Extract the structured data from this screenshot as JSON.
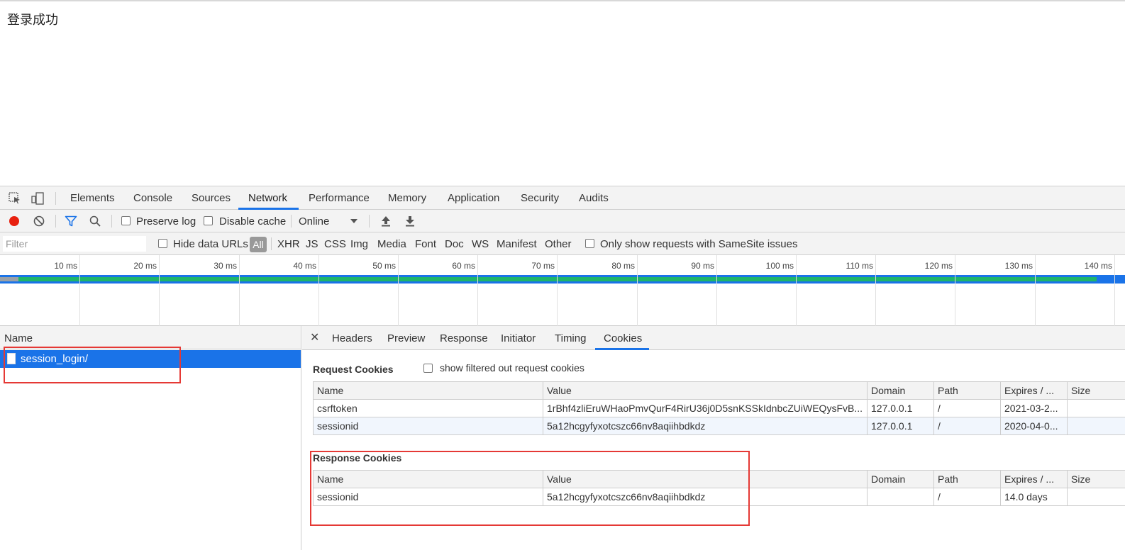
{
  "page": {
    "message": "登录成功"
  },
  "devtools": {
    "tabs": [
      "Elements",
      "Console",
      "Sources",
      "Network",
      "Performance",
      "Memory",
      "Application",
      "Security",
      "Audits"
    ],
    "active_tab": "Network",
    "toolbar": {
      "preserve_log": "Preserve log",
      "disable_cache": "Disable cache",
      "throttle": "Online"
    },
    "filter": {
      "placeholder": "Filter",
      "hide_data_urls": "Hide data URLs",
      "types": [
        "All",
        "XHR",
        "JS",
        "CSS",
        "Img",
        "Media",
        "Font",
        "Doc",
        "WS",
        "Manifest",
        "Other"
      ],
      "samesite": "Only show requests with SameSite issues"
    },
    "timeline": {
      "ticks": [
        "10 ms",
        "20 ms",
        "30 ms",
        "40 ms",
        "50 ms",
        "60 ms",
        "70 ms",
        "80 ms",
        "90 ms",
        "100 ms",
        "110 ms",
        "120 ms",
        "130 ms",
        "140 ms"
      ]
    },
    "requests": {
      "header": "Name",
      "items": [
        "session_login/"
      ]
    },
    "details": {
      "tabs": [
        "Headers",
        "Preview",
        "Response",
        "Initiator",
        "Timing",
        "Cookies"
      ],
      "active_tab": "Cookies",
      "request_cookies": {
        "title": "Request Cookies",
        "show_filtered": "show filtered out request cookies",
        "columns": [
          "Name",
          "Value",
          "Domain",
          "Path",
          "Expires / ...",
          "Size"
        ],
        "rows": [
          [
            "csrftoken",
            "1rBhf4zliEruWHaoPmvQurF4RirU36j0D5snKSSkIdnbcZUiWEQysFvB...",
            "127.0.0.1",
            "/",
            "2021-03-2...",
            ""
          ],
          [
            "sessionid",
            "5a12hcgyfyxotcszc66nv8aqiihbdkdz",
            "127.0.0.1",
            "/",
            "2020-04-0...",
            ""
          ]
        ]
      },
      "response_cookies": {
        "title": "Response Cookies",
        "columns": [
          "Name",
          "Value",
          "Domain",
          "Path",
          "Expires / ...",
          "Size"
        ],
        "rows": [
          [
            "sessionid",
            "5a12hcgyfyxotcszc66nv8aqiihbdkdz",
            "",
            "/",
            "14.0 days",
            ""
          ]
        ]
      }
    },
    "colors": {
      "accent": "#1a73e8",
      "highlight": "#e53935",
      "record": "#e8200f",
      "timeline_green": "#1fb56a"
    }
  }
}
